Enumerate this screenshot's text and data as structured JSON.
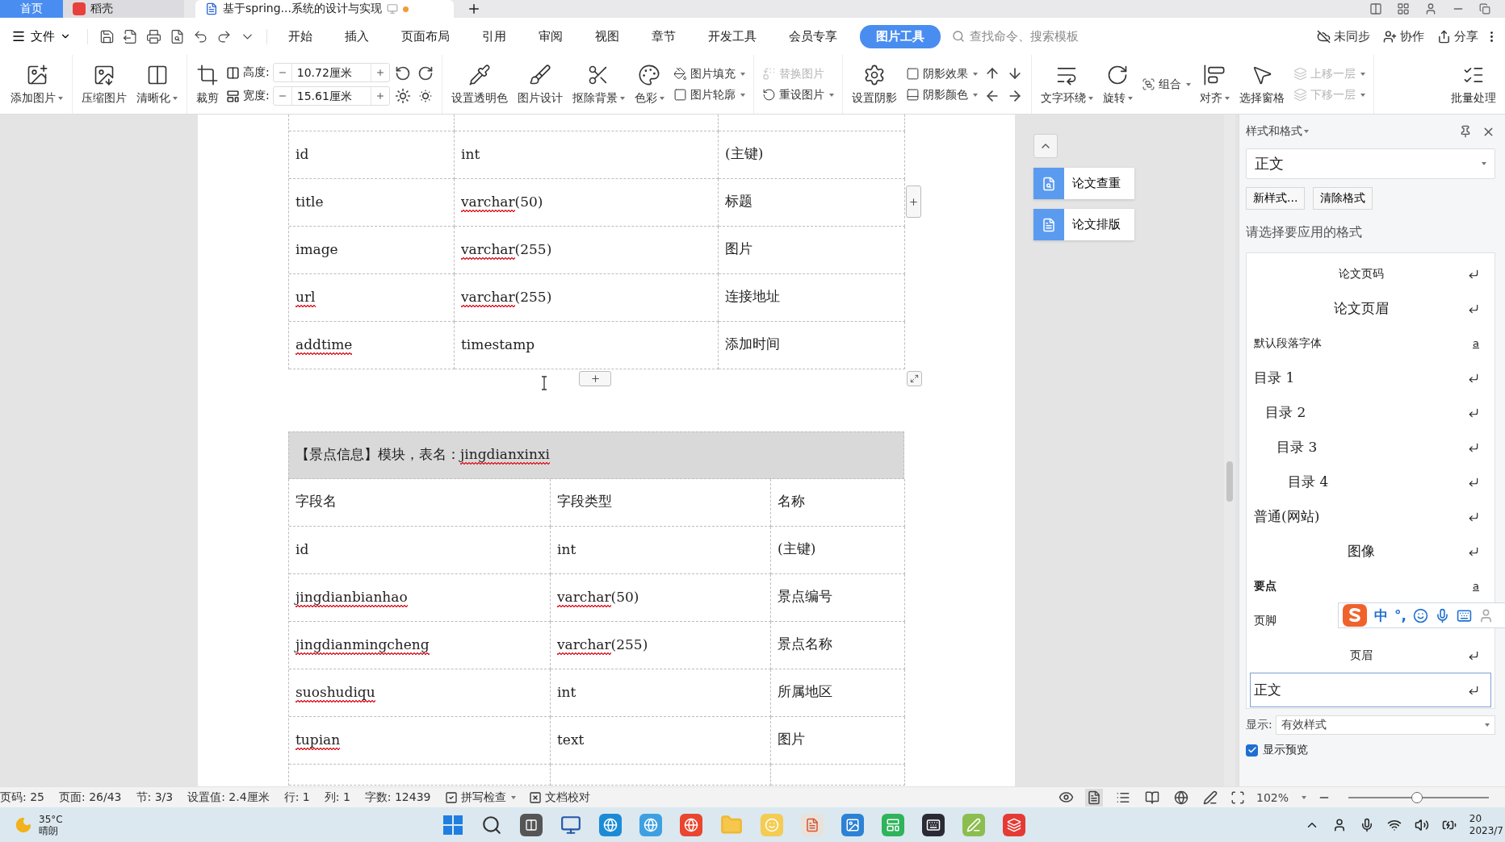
{
  "tabs": [
    {
      "label": "首页",
      "kind": "home",
      "selected": false
    },
    {
      "label": "稻壳",
      "kind": "docer",
      "selected": false
    },
    {
      "label": "基于spring...系统的设计与实现",
      "kind": "doc",
      "selected": true
    }
  ],
  "menu": {
    "file": "文件",
    "tabs": [
      {
        "label": "开始",
        "selected": false
      },
      {
        "label": "插入",
        "selected": false
      },
      {
        "label": "页面布局",
        "selected": false
      },
      {
        "label": "引用",
        "selected": false
      },
      {
        "label": "审阅",
        "selected": false
      },
      {
        "label": "视图",
        "selected": false
      },
      {
        "label": "章节",
        "selected": false
      },
      {
        "label": "开发工具",
        "selected": false
      },
      {
        "label": "会员专享",
        "selected": false
      },
      {
        "label": "图片工具",
        "selected": true
      }
    ],
    "search": {
      "placeholder": "查找命令、搜索模板"
    },
    "actions": [
      "未同步",
      "协作",
      "分享"
    ]
  },
  "ribbon": [
    [
      {
        "kind": "large",
        "label": "添加图片",
        "dropdown": true
      }
    ],
    [
      {
        "kind": "large",
        "label": "压缩图片",
        "dropdown": false
      },
      {
        "kind": "large",
        "label": "清晰化",
        "dropdown": true
      }
    ],
    [
      {
        "kind": "large",
        "label": "裁剪",
        "dropdown": false
      },
      {
        "kind": "size",
        "fields": [
          {
            "label": "高度:",
            "value": "10.72厘米"
          },
          {
            "label": "宽度:",
            "value": "15.61厘米"
          }
        ]
      },
      {
        "kind": "rotate-grid"
      }
    ],
    [
      {
        "kind": "large",
        "label": "设置透明色",
        "dropdown": false
      },
      {
        "kind": "large",
        "label": "图片设计",
        "dropdown": false
      },
      {
        "kind": "large",
        "label": "抠除背景",
        "dropdown": true
      },
      {
        "kind": "large",
        "label": "色彩",
        "dropdown": true
      },
      {
        "kind": "stack",
        "items": [
          {
            "label": "图片填充",
            "dropdown": true,
            "disabled": false
          },
          {
            "label": "图片轮廓",
            "dropdown": true,
            "disabled": false
          }
        ]
      }
    ],
    [
      {
        "kind": "stack",
        "items": [
          {
            "label": "替换图片",
            "dropdown": false,
            "disabled": true
          },
          {
            "label": "重设图片",
            "dropdown": true,
            "disabled": false
          }
        ]
      }
    ],
    [
      {
        "kind": "large",
        "label": "设置阴影",
        "dropdown": false
      },
      {
        "kind": "stack",
        "items": [
          {
            "label": "阴影效果",
            "dropdown": true,
            "disabled": false
          },
          {
            "label": "阴影颜色",
            "dropdown": true,
            "disabled": false
          }
        ]
      },
      {
        "kind": "nudge-grid"
      }
    ],
    [
      {
        "kind": "large",
        "label": "文字环绕",
        "dropdown": true
      },
      {
        "kind": "large",
        "label": "旋转",
        "dropdown": true
      },
      {
        "kind": "stack",
        "items": [
          {
            "label": "组合",
            "dropdown": true,
            "disabled": false
          }
        ]
      },
      {
        "kind": "large",
        "label": "对齐",
        "dropdown": true
      },
      {
        "kind": "large",
        "label": "选择窗格",
        "dropdown": false
      },
      {
        "kind": "stack",
        "items": [
          {
            "label": "上移一层",
            "dropdown": true,
            "disabled": true
          },
          {
            "label": "下移一层",
            "dropdown": true,
            "disabled": true
          }
        ]
      }
    ],
    [
      {
        "kind": "large",
        "label": "批量处理",
        "dropdown": false
      }
    ]
  ],
  "document": {
    "tables": [
      {
        "rows": [
          {
            "kind": "partial"
          },
          {
            "kind": "row",
            "cells": [
              {
                "parts": [
                  {
                    "text": "id",
                    "misspelled": false
                  }
                ]
              },
              {
                "parts": [
                  {
                    "text": "int",
                    "misspelled": false
                  }
                ]
              },
              {
                "parts": [
                  {
                    "text": "(主键)",
                    "misspelled": false
                  }
                ]
              }
            ]
          },
          {
            "kind": "row",
            "cells": [
              {
                "parts": [
                  {
                    "text": "title",
                    "misspelled": false
                  }
                ]
              },
              {
                "parts": [
                  {
                    "text": "varchar",
                    "misspelled": true
                  },
                  {
                    "text": "(50)",
                    "misspelled": false
                  }
                ]
              },
              {
                "parts": [
                  {
                    "text": "标题",
                    "misspelled": false
                  }
                ]
              }
            ]
          },
          {
            "kind": "row",
            "cells": [
              {
                "parts": [
                  {
                    "text": "image",
                    "misspelled": false
                  }
                ]
              },
              {
                "parts": [
                  {
                    "text": "varchar",
                    "misspelled": true
                  },
                  {
                    "text": "(255)",
                    "misspelled": false
                  }
                ]
              },
              {
                "parts": [
                  {
                    "text": "图片",
                    "misspelled": false
                  }
                ]
              }
            ]
          },
          {
            "kind": "row",
            "cells": [
              {
                "parts": [
                  {
                    "text": "url",
                    "misspelled": true
                  }
                ]
              },
              {
                "parts": [
                  {
                    "text": "varchar",
                    "misspelled": true
                  },
                  {
                    "text": "(255)",
                    "misspelled": false
                  }
                ]
              },
              {
                "parts": [
                  {
                    "text": "连接地址",
                    "misspelled": false
                  }
                ]
              }
            ]
          },
          {
            "kind": "row",
            "cells": [
              {
                "parts": [
                  {
                    "text": "addtime",
                    "misspelled": true
                  }
                ]
              },
              {
                "parts": [
                  {
                    "text": "timestamp",
                    "misspelled": false
                  }
                ]
              },
              {
                "parts": [
                  {
                    "text": "添加时间",
                    "misspelled": false
                  }
                ]
              }
            ]
          }
        ]
      },
      {
        "caption": [
          {
            "text": "【景点信息】模块，表名：",
            "misspelled": false
          },
          {
            "text": "jingdianxinxi",
            "misspelled": true
          }
        ],
        "rows": [
          {
            "kind": "row",
            "cells": [
              {
                "parts": [
                  {
                    "text": "字段名",
                    "misspelled": false
                  }
                ]
              },
              {
                "parts": [
                  {
                    "text": "字段类型",
                    "misspelled": false
                  }
                ]
              },
              {
                "parts": [
                  {
                    "text": "名称",
                    "misspelled": false
                  }
                ]
              }
            ]
          },
          {
            "kind": "row",
            "cells": [
              {
                "parts": [
                  {
                    "text": "id",
                    "misspelled": false
                  }
                ]
              },
              {
                "parts": [
                  {
                    "text": "int",
                    "misspelled": false
                  }
                ]
              },
              {
                "parts": [
                  {
                    "text": "(主键)",
                    "misspelled": false
                  }
                ]
              }
            ]
          },
          {
            "kind": "row",
            "cells": [
              {
                "parts": [
                  {
                    "text": "jingdianbianhao",
                    "misspelled": true
                  }
                ]
              },
              {
                "parts": [
                  {
                    "text": "varchar",
                    "misspelled": true
                  },
                  {
                    "text": "(50)",
                    "misspelled": false
                  }
                ]
              },
              {
                "parts": [
                  {
                    "text": "景点编号",
                    "misspelled": false
                  }
                ]
              }
            ]
          },
          {
            "kind": "row",
            "cells": [
              {
                "parts": [
                  {
                    "text": "jingdianmingcheng",
                    "misspelled": true
                  }
                ]
              },
              {
                "parts": [
                  {
                    "text": "varchar",
                    "misspelled": true
                  },
                  {
                    "text": "(255)",
                    "misspelled": false
                  }
                ]
              },
              {
                "parts": [
                  {
                    "text": "景点名称",
                    "misspelled": false
                  }
                ]
              }
            ]
          },
          {
            "kind": "row",
            "cells": [
              {
                "parts": [
                  {
                    "text": "suoshudiqu",
                    "misspelled": true
                  }
                ]
              },
              {
                "parts": [
                  {
                    "text": "int",
                    "misspelled": false
                  }
                ]
              },
              {
                "parts": [
                  {
                    "text": "所属地区",
                    "misspelled": false
                  }
                ]
              }
            ]
          },
          {
            "kind": "row",
            "cells": [
              {
                "parts": [
                  {
                    "text": "tupian",
                    "misspelled": true
                  }
                ]
              },
              {
                "parts": [
                  {
                    "text": "text",
                    "misspelled": false
                  }
                ]
              },
              {
                "parts": [
                  {
                    "text": "图片",
                    "misspelled": false
                  }
                ]
              }
            ]
          },
          {
            "kind": "partial"
          }
        ]
      }
    ]
  },
  "side_tools": [
    "论文查重",
    "论文排版"
  ],
  "styles_panel": {
    "title": "样式和格式",
    "current": "正文",
    "buttons": [
      "新样式...",
      "清除格式"
    ],
    "prompt": "请选择要应用的格式",
    "styles": [
      {
        "label": "论文页码",
        "kind": "centered",
        "serif": false,
        "bold": false,
        "return_mark": true,
        "selected": false
      },
      {
        "label": "论文页眉",
        "kind": "centered",
        "serif": true,
        "bold": false,
        "return_mark": true,
        "selected": false
      },
      {
        "label": "默认段落字体",
        "kind": "plain",
        "serif": false,
        "bold": false,
        "return_mark": false,
        "mark": "a",
        "selected": false
      },
      {
        "label": "目录 1",
        "kind": "toc1",
        "serif": true,
        "bold": false,
        "return_mark": true,
        "selected": false
      },
      {
        "label": "目录 2",
        "kind": "toc2",
        "serif": true,
        "bold": false,
        "return_mark": true,
        "selected": false
      },
      {
        "label": "目录 3",
        "kind": "toc3",
        "serif": true,
        "bold": false,
        "return_mark": true,
        "selected": false
      },
      {
        "label": "目录 4",
        "kind": "toc4",
        "serif": true,
        "bold": false,
        "return_mark": true,
        "selected": false
      },
      {
        "label": "普通(网站)",
        "kind": "plain",
        "serif": true,
        "bold": false,
        "return_mark": true,
        "selected": false
      },
      {
        "label": "图像",
        "kind": "centered",
        "serif": true,
        "bold": false,
        "return_mark": true,
        "selected": false
      },
      {
        "label": "要点",
        "kind": "plain",
        "serif": false,
        "bold": true,
        "return_mark": false,
        "mark": "a",
        "selected": false
      },
      {
        "label": "页脚",
        "kind": "plain",
        "serif": false,
        "bold": false,
        "selected": false
      },
      {
        "label": "页眉",
        "kind": "centered",
        "serif": false,
        "bold": false,
        "return_mark": true,
        "selected": false
      },
      {
        "label": "正文",
        "kind": "plain",
        "serif": true,
        "bold": false,
        "return_mark": true,
        "selected": true
      }
    ],
    "show_label": "显示:",
    "show_value": "有效样式",
    "preview": {
      "label": "显示预览",
      "checked": true
    }
  },
  "ime": [
    "中",
    "°,"
  ],
  "status_bar": {
    "items": [
      "页码: 25",
      "页面: 26/43",
      "节: 3/3",
      "设置值: 2.4厘米",
      "行: 1",
      "列: 1",
      "字数: 12439"
    ],
    "spell": "拼写检查",
    "proof": "文档校对",
    "zoom": "102%",
    "zoom_slider": {
      "level": 0.49
    }
  },
  "taskbar": {
    "temperature": "35°C",
    "weather": "晴朗",
    "clock": [
      "20",
      "2023/7"
    ]
  }
}
